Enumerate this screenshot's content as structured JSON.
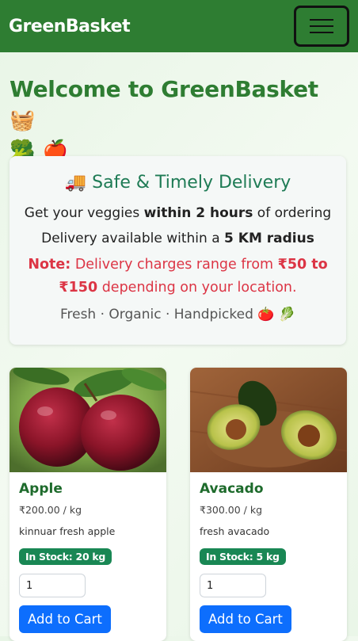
{
  "navbar": {
    "brand": "GreenBasket",
    "toggle_icon": "hamburger-icon"
  },
  "hero": {
    "title": "Welcome to GreenBasket",
    "emoji_1": "🧺",
    "emoji_2": "🥦",
    "emoji_3": "🍎"
  },
  "delivery": {
    "icon": "🚚",
    "title": "Safe & Timely Delivery",
    "line1_pre": "Get your veggies ",
    "line1_bold": "within 2 hours",
    "line1_post": " of ordering",
    "line2_pre": "Delivery available within a ",
    "line2_bold": "5 KM radius",
    "note_label": "Note:",
    "note_pre": " Delivery charges range from ",
    "note_bold": "₹50 to ₹150",
    "note_post": " depending on your location.",
    "tagline": "Fresh · Organic · Handpicked",
    "tag_emoji_1": "🍅",
    "tag_emoji_2": "🥬"
  },
  "products": [
    {
      "name": "Apple",
      "price": "₹200.00 / kg",
      "description": "kinnuar fresh apple",
      "stock": "In Stock: 20 kg",
      "quantity": "1",
      "button": "Add to Cart"
    },
    {
      "name": "Avacado",
      "price": "₹300.00 / kg",
      "description": "fresh avacado",
      "stock": "In Stock: 5 kg",
      "quantity": "1",
      "button": "Add to Cart"
    }
  ],
  "colors": {
    "navbar": "#2e7d32",
    "title": "#2e7d32",
    "note": "#dc3545",
    "stock_badge": "#198754",
    "button": "#0d6efd"
  }
}
